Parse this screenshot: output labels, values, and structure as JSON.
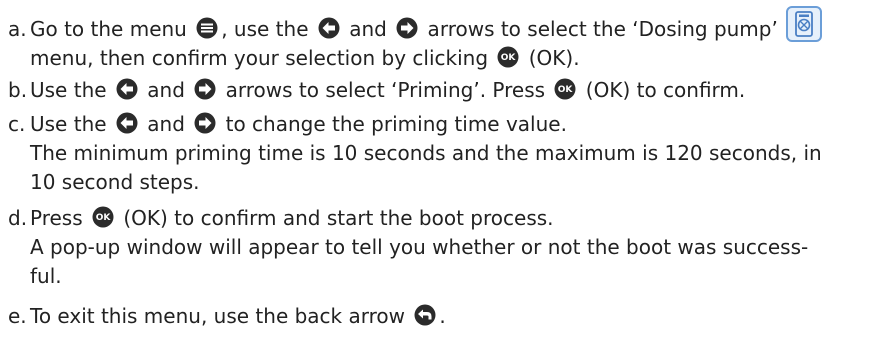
{
  "icons": {
    "menu": "menu-icon",
    "left": "left-arrow-icon",
    "right": "right-arrow-icon",
    "ok": "ok-button-icon",
    "back": "back-arrow-icon",
    "dosing": "dosing-pump-menu-icon"
  },
  "colors": {
    "icon": "#2b2b2b",
    "tile_border": "#6b9ed8",
    "tile_bg": "#e6f0fb"
  },
  "ok_glyph": "OK",
  "steps": [
    {
      "marker": "a.",
      "l1_a": "Go to the menu ",
      "l1_b": ", use the ",
      "l1_c": " and ",
      "l1_d": " arrows to select the ‘Dosing pump’ ",
      "l2_a": "menu, then confirm your selection by clicking ",
      "l2_b": " (OK)."
    },
    {
      "marker": "b.",
      "l1_a": "Use the ",
      "l1_b": " and ",
      "l1_c": " arrows to select ‘Priming’. Press ",
      "l1_d": " (OK) to confirm."
    },
    {
      "marker": "c.",
      "l1_a": "Use the ",
      "l1_b": " and ",
      "l1_c": " to change the priming time value.",
      "l2": "The minimum priming time is 10 seconds and the maximum is 120 seconds, in",
      "l3": "10 second steps."
    },
    {
      "marker": "d.",
      "l1_a": "Press ",
      "l1_b": " (OK) to confirm and start the boot process.",
      "l2": "A pop-up window will appear to tell you whether or not the boot was success-",
      "l3": "ful."
    },
    {
      "marker": "e.",
      "l1_a": "To exit this menu, use the back arrow ",
      "l1_b": "."
    }
  ]
}
